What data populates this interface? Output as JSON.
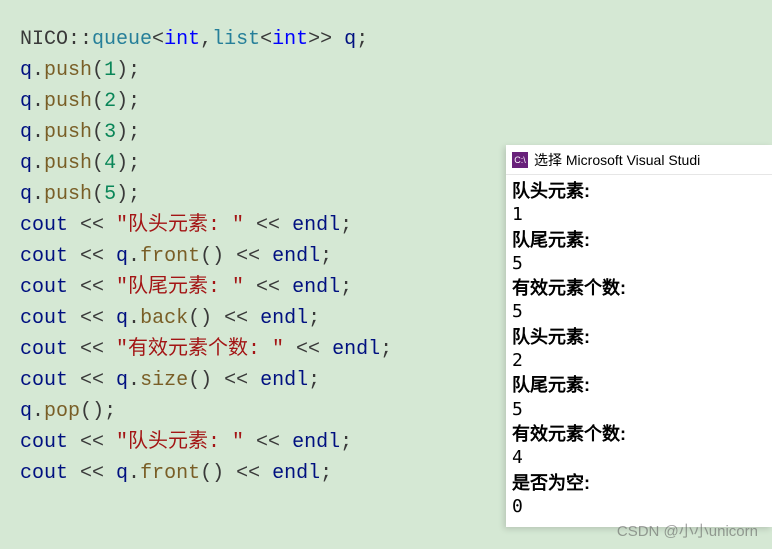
{
  "code": {
    "lines": [
      {
        "t": "decl",
        "ns": "NICO",
        "op": "::",
        "tpl1": "queue",
        "lt": "<",
        "kw1": "int",
        "cm": ",",
        "tpl2": "list",
        "lt2": "<",
        "kw2": "int",
        "gt2": ">>",
        "sp": " ",
        "var": "q",
        "sc": ";"
      },
      {
        "t": "push",
        "var": "q",
        "dot": ".",
        "fn": "push",
        "lp": "(",
        "num": "1",
        "rp": ")",
        "sc": ";"
      },
      {
        "t": "push",
        "var": "q",
        "dot": ".",
        "fn": "push",
        "lp": "(",
        "num": "2",
        "rp": ")",
        "sc": ";"
      },
      {
        "t": "push",
        "var": "q",
        "dot": ".",
        "fn": "push",
        "lp": "(",
        "num": "3",
        "rp": ")",
        "sc": ";"
      },
      {
        "t": "push",
        "var": "q",
        "dot": ".",
        "fn": "push",
        "lp": "(",
        "num": "4",
        "rp": ")",
        "sc": ";"
      },
      {
        "t": "push",
        "var": "q",
        "dot": ".",
        "fn": "push",
        "lp": "(",
        "num": "5",
        "rp": ")",
        "sc": ";"
      },
      {
        "t": "coutstr",
        "cout": "cout",
        "op1": " << ",
        "str": "\"队头元素: \"",
        "op2": " << ",
        "endl": "endl",
        "sc": ";"
      },
      {
        "t": "coutexp",
        "cout": "cout",
        "op1": " << ",
        "var": "q",
        "dot": ".",
        "fn": "front",
        "lp": "(",
        "rp": ")",
        "op2": " << ",
        "endl": "endl",
        "sc": ";"
      },
      {
        "t": "coutstr",
        "cout": "cout",
        "op1": " << ",
        "str": "\"队尾元素: \"",
        "op2": " << ",
        "endl": "endl",
        "sc": ";"
      },
      {
        "t": "coutexp",
        "cout": "cout",
        "op1": " << ",
        "var": "q",
        "dot": ".",
        "fn": "back",
        "lp": "(",
        "rp": ")",
        "op2": " << ",
        "endl": "endl",
        "sc": ";"
      },
      {
        "t": "coutstr",
        "cout": "cout",
        "op1": " << ",
        "str": "\"有效元素个数: \"",
        "op2": " << ",
        "endl": "endl",
        "sc": ";"
      },
      {
        "t": "coutexp",
        "cout": "cout",
        "op1": " << ",
        "var": "q",
        "dot": ".",
        "fn": "size",
        "lp": "(",
        "rp": ")",
        "op2": " << ",
        "endl": "endl",
        "sc": ";"
      },
      {
        "t": "call",
        "var": "q",
        "dot": ".",
        "fn": "pop",
        "lp": "(",
        "rp": ")",
        "sc": ";"
      },
      {
        "t": "coutstr",
        "cout": "cout",
        "op1": " << ",
        "str": "\"队头元素: \"",
        "op2": " << ",
        "endl": "endl",
        "sc": ";"
      },
      {
        "t": "coutexp",
        "cout": "cout",
        "op1": " << ",
        "var": "q",
        "dot": ".",
        "fn": "front",
        "lp": "(",
        "rp": ")",
        "op2": " << ",
        "endl": "endl",
        "sc": ";"
      }
    ]
  },
  "console": {
    "icon_label": "C:\\",
    "title": "选择 Microsoft Visual Studi",
    "lines": [
      {
        "label": "队头元素:",
        "value": "1"
      },
      {
        "label": "队尾元素:",
        "value": "5"
      },
      {
        "label": "有效元素个数:",
        "value": "5"
      },
      {
        "label": "队头元素:",
        "value": "2"
      },
      {
        "label": "队尾元素:",
        "value": "5"
      },
      {
        "label": "有效元素个数:",
        "value": "4"
      },
      {
        "label": "是否为空:",
        "value": "0"
      }
    ]
  },
  "watermark": "CSDN @小小unicorn"
}
